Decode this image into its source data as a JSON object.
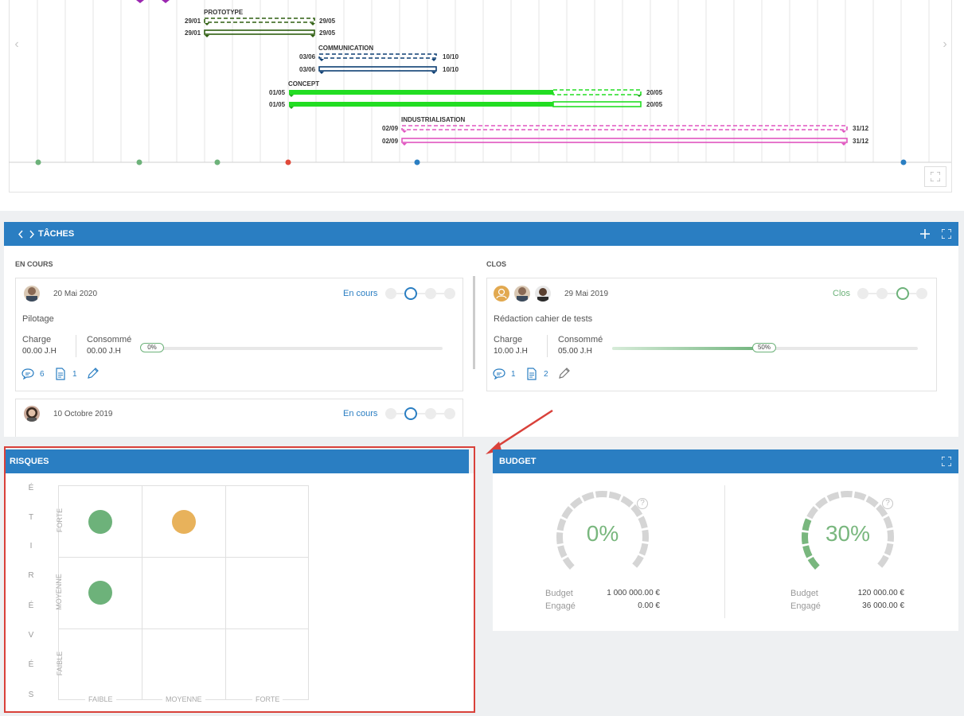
{
  "gantt": {
    "phases": [
      {
        "name": "PROTOTYPE",
        "start": "29/01",
        "end": "29/05",
        "color": "#2e5e10"
      },
      {
        "name": "COMMUNICATION",
        "start": "03/06",
        "end": "10/10",
        "color": "#0d3f73"
      },
      {
        "name": "CONCEPT",
        "start": "01/05",
        "end": "20/05",
        "color": "#22dd22"
      },
      {
        "name": "INDUSTRIALISATION",
        "start": "02/09",
        "end": "31/12",
        "color": "#e055c0"
      }
    ],
    "milestone_colors": [
      "#6db27a",
      "#6db27a",
      "#6db27a",
      "#e04a3a",
      "#2a7ec2",
      "#2a7ec2"
    ],
    "nav_prev": "‹",
    "nav_next": "›"
  },
  "tasks": {
    "title": "TÂCHES",
    "col_open": "EN COURS",
    "col_closed": "CLOS",
    "cards": [
      {
        "date": "20 Mai 2020",
        "status": "En cours",
        "title": "Pilotage",
        "charge_label": "Charge",
        "charge": "00.00 J.H",
        "consumed_label": "Consommé",
        "consumed": "00.00 J.H",
        "progress": "0%",
        "comments": "6",
        "docs": "1"
      },
      {
        "date": "10 Octobre 2019",
        "status": "En cours"
      },
      {
        "date": "29 Mai 2019",
        "status": "Clos",
        "title": "Rédaction cahier de tests",
        "charge_label": "Charge",
        "charge": "10.00 J.H",
        "consumed_label": "Consommé",
        "consumed": "05.00 J.H",
        "progress": "50%",
        "comments": "1",
        "docs": "2"
      }
    ]
  },
  "risks": {
    "title": "RISQUES",
    "severity_axis": [
      "S",
      "É",
      "V",
      "É",
      "R",
      "I",
      "T",
      "É"
    ],
    "severity_levels": [
      "FORTE",
      "MOYENNE",
      "FAIBLE"
    ],
    "probability_levels": [
      "FAIBLE",
      "MOYENNE",
      "FORTE"
    ],
    "colors": {
      "green": "#6db27a",
      "orange": "#e8b25b"
    }
  },
  "budget": {
    "title": "BUDGET",
    "gauges": [
      {
        "percent": "0%",
        "budget_label": "Budget",
        "budget": "1 000 000.00 €",
        "engaged_label": "Engagé",
        "engaged": "0.00 €"
      },
      {
        "percent": "30%",
        "budget_label": "Budget",
        "budget": "120 000.00 €",
        "engaged_label": "Engagé",
        "engaged": "36 000.00 €"
      }
    ],
    "help": "?"
  }
}
